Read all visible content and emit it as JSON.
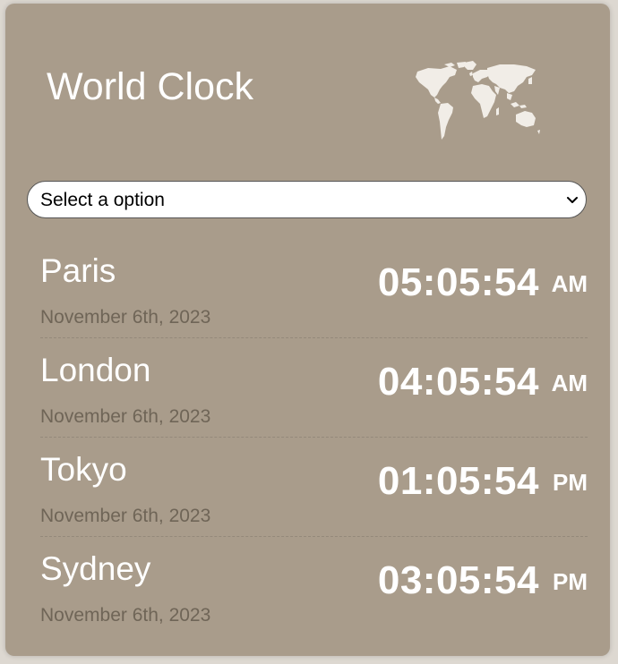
{
  "header": {
    "title": "World Clock",
    "map_icon": "world-map-icon"
  },
  "select": {
    "value": "Select a option",
    "arrow_icon": "chevron-down-icon"
  },
  "clocks": [
    {
      "city": "Paris",
      "date": "November 6th, 2023",
      "time": "05:05:54",
      "period": "AM"
    },
    {
      "city": "London",
      "date": "November 6th, 2023",
      "time": "04:05:54",
      "period": "AM"
    },
    {
      "city": "Tokyo",
      "date": "November 6th, 2023",
      "time": "01:05:54",
      "period": "PM"
    },
    {
      "city": "Sydney",
      "date": "November 6th, 2023",
      "time": "03:05:54",
      "period": "PM"
    }
  ],
  "colors": {
    "card_background": "#a99c8b",
    "text_primary": "#ffffff",
    "text_date": "#6f6557"
  }
}
